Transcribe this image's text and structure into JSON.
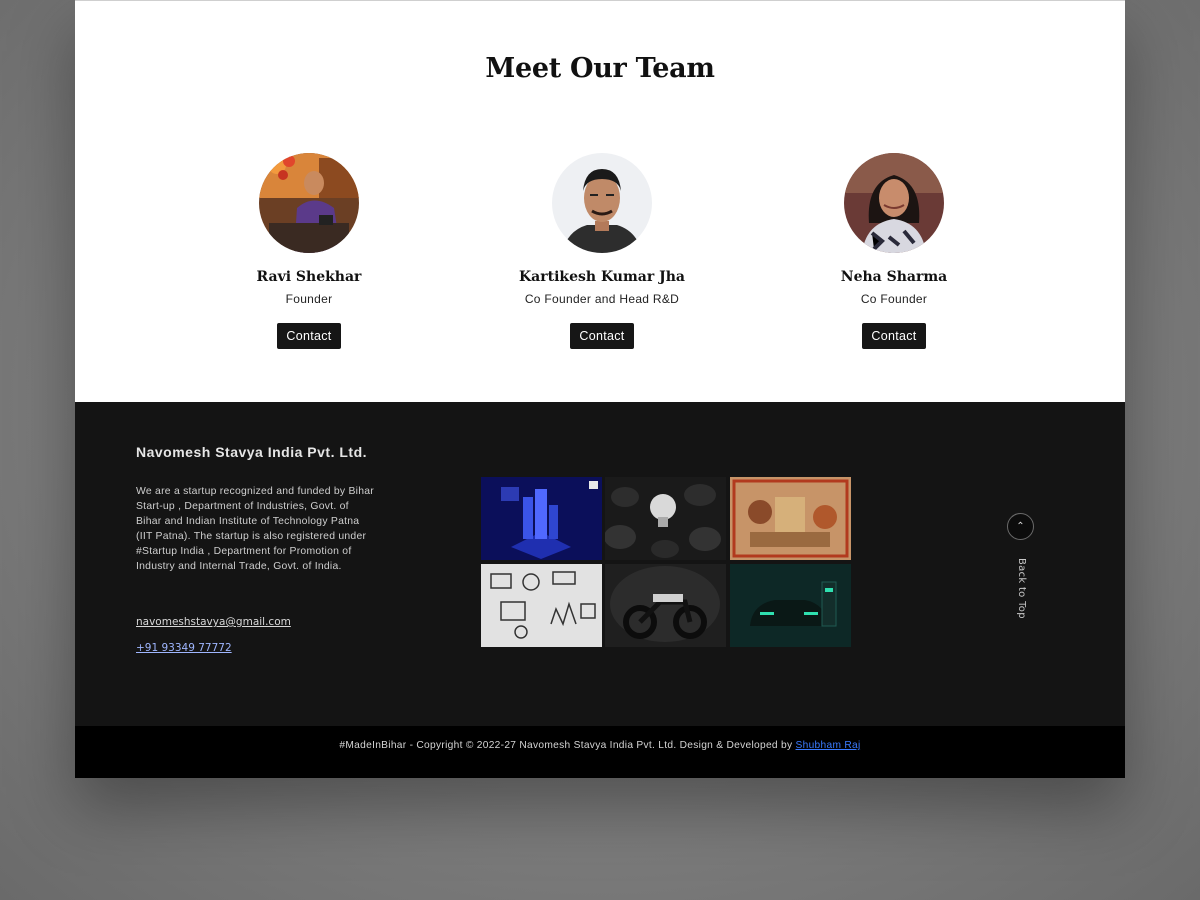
{
  "team": {
    "title": "Meet Our Team",
    "members": [
      {
        "name": "Ravi Shekhar",
        "role": "Founder",
        "contact_label": "Contact"
      },
      {
        "name": "Kartikesh Kumar Jha",
        "role": "Co Founder and Head R&D",
        "contact_label": "Contact"
      },
      {
        "name": "Neha Sharma",
        "role": "Co Founder",
        "contact_label": "Contact"
      }
    ]
  },
  "footer": {
    "company": "Navomesh Stavya India Pvt. Ltd.",
    "about": "We are a startup recognized and funded by Bihar Start-up , Department of Industries, Govt. of Bihar and Indian Institute of Technology Patna (IIT Patna). The startup is also registered under #Startup India , Department for Promotion of Industry and Internal Trade, Govt. of India.",
    "email": "navomeshstavya@gmail.com",
    "phone": "+91 93349 77772",
    "back_to_top": "Back to Top",
    "back_to_top_icon": "chevron-up-icon"
  },
  "copyright": {
    "text": "#MadeInBihar - Copyright © 2022-27 Navomesh Stavya India Pvt. Ltd. Design & Developed by",
    "developer": "Shubham Raj"
  },
  "colors": {
    "footer_bg": "#141414",
    "copyright_bg": "#000000",
    "button_bg": "#161616",
    "link": "#3a7bff"
  }
}
